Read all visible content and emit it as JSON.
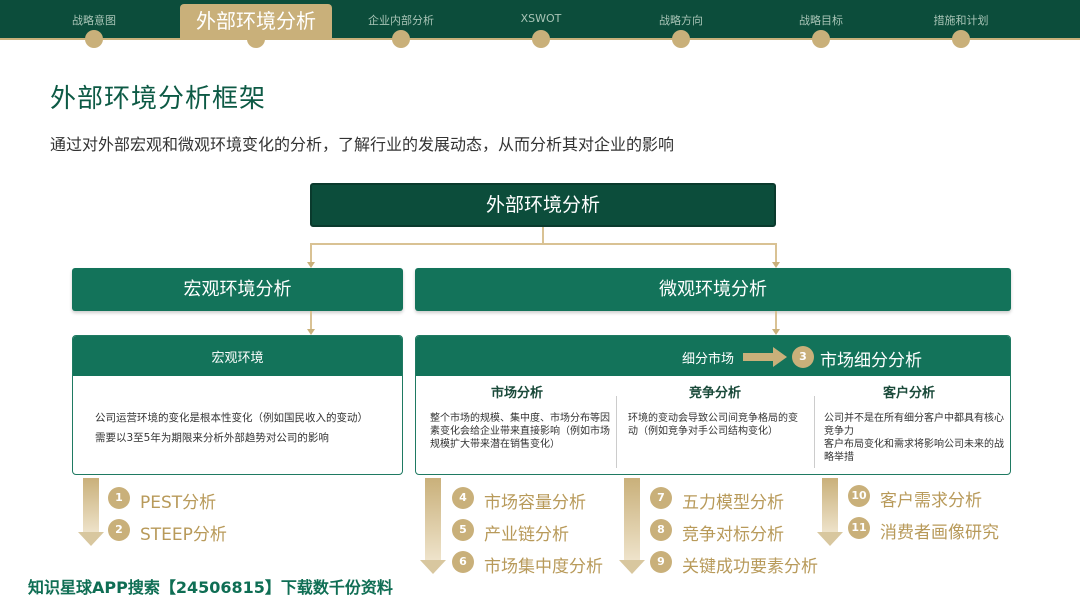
{
  "nav": {
    "items": [
      "战略意图",
      "外部环境分析",
      "企业内部分析",
      "XSWOT",
      "战略方向",
      "战略目标",
      "措施和计划"
    ],
    "active_index": 1
  },
  "header": {
    "title": "外部环境分析框架",
    "subtitle": "通过对外部宏观和微观环境变化的分析，了解行业的发展动态，从而分析其对企业的影响"
  },
  "framework": {
    "root": "外部环境分析",
    "macro": {
      "title": "宏观环境分析",
      "panel_title": "宏观环境",
      "lines": [
        "公司运营环境的变化是根本性变化（例如国民收入的变动）",
        "需要以3至5年为期限来分析外部趋势对公司的影响"
      ]
    },
    "micro": {
      "title": "微观环境分析",
      "segment_label": "细分市场",
      "segment_num": "3",
      "segment_title": "市场细分分析",
      "columns": [
        {
          "title": "市场分析",
          "text": "整个市场的规模、集中度、市场分布等因素变化会给企业带来直接影响（例如市场规模扩大带来潜在销售变化）"
        },
        {
          "title": "竞争分析",
          "text": "环境的变动会导致公司间竞争格局的变动（例如竞争对手公司结构变化）"
        },
        {
          "title": "客户分析",
          "text": "公司并不是在所有细分客户中都具有核心竞争力\n客户布局变化和需求将影响公司未来的战略举措"
        }
      ]
    }
  },
  "lists": {
    "macro": [
      {
        "num": "1",
        "label": "PEST分析"
      },
      {
        "num": "2",
        "label": "STEEP分析"
      }
    ],
    "market": [
      {
        "num": "4",
        "label": "市场容量分析"
      },
      {
        "num": "5",
        "label": "产业链分析"
      },
      {
        "num": "6",
        "label": "市场集中度分析"
      }
    ],
    "competition": [
      {
        "num": "7",
        "label": "五力模型分析"
      },
      {
        "num": "8",
        "label": "竞争对标分析"
      },
      {
        "num": "9",
        "label": "关键成功要素分析"
      }
    ],
    "customer": [
      {
        "num": "10",
        "label": "客户需求分析"
      },
      {
        "num": "11",
        "label": "消费者画像研究"
      }
    ]
  },
  "footer": {
    "watermark": "知识星球APP搜索【24506815】下载数千份资料"
  },
  "colors": {
    "dark_green": "#0c4d3b",
    "teal": "#13735a",
    "gold": "#c9b07a"
  }
}
